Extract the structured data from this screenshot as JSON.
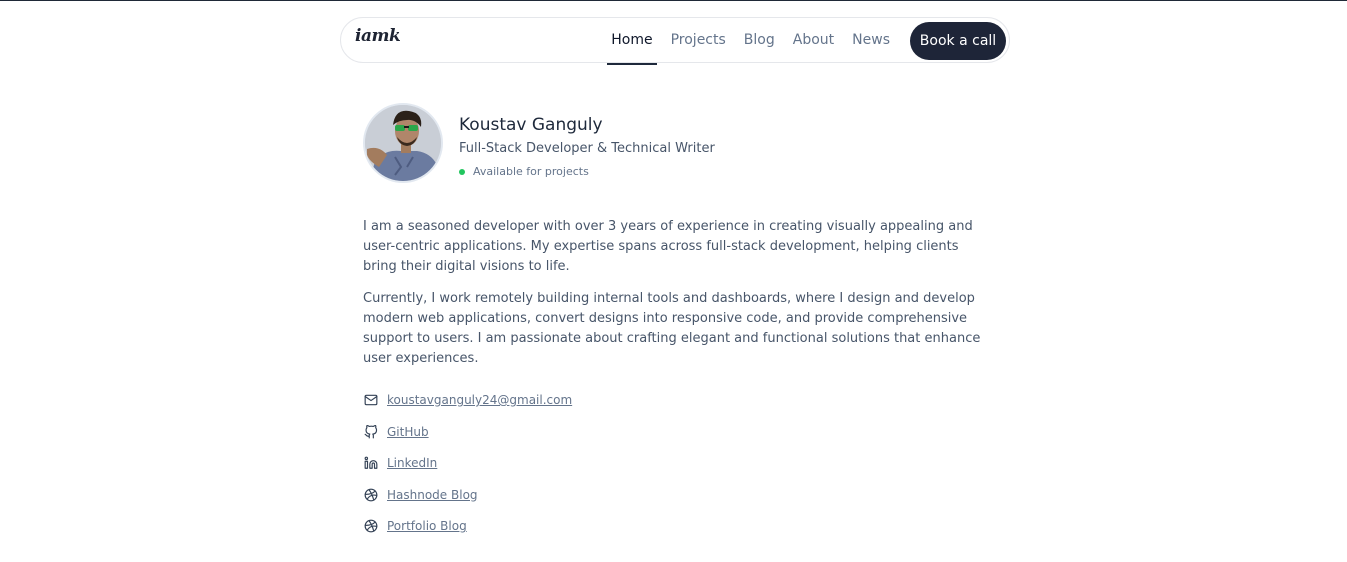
{
  "nav": {
    "logo": "iamk",
    "links": [
      {
        "label": "Home",
        "active": true
      },
      {
        "label": "Projects",
        "active": false
      },
      {
        "label": "Blog",
        "active": false
      },
      {
        "label": "About",
        "active": false
      },
      {
        "label": "News",
        "active": false
      }
    ],
    "cta": "Book a call"
  },
  "profile": {
    "name": "Koustav Ganguly",
    "role": "Full-Stack Developer & Technical Writer",
    "status": "Available for projects",
    "status_color": "#22c55e"
  },
  "bio": {
    "paragraphs": [
      "I am a seasoned developer with over 3 years of experience in creating visually appealing and user-centric applications. My expertise spans across full-stack development, helping clients bring their digital visions to life.",
      "Currently, I work remotely building internal tools and dashboards, where I design and develop modern web applications, convert designs into responsive code, and provide comprehensive support to users. I am passionate about crafting elegant and functional solutions that enhance user experiences."
    ]
  },
  "links": [
    {
      "label": "koustavganguly24@gmail.com",
      "icon": "mail-icon"
    },
    {
      "label": "GitHub",
      "icon": "github-icon"
    },
    {
      "label": "LinkedIn",
      "icon": "linkedin-icon"
    },
    {
      "label": "Hashnode Blog",
      "icon": "dribbble-icon"
    },
    {
      "label": "Portfolio Blog",
      "icon": "dribbble-icon"
    }
  ],
  "colors": {
    "accent": "#1e2538",
    "text": "#1e293b",
    "muted": "#64748b"
  }
}
